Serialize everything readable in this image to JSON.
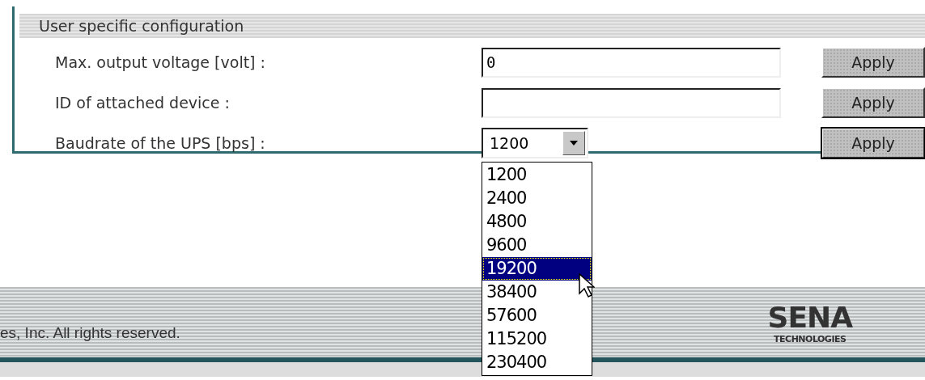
{
  "section": {
    "title": "User specific configuration",
    "settings": [
      {
        "kind": "text",
        "label": "Max. output voltage [volt] :",
        "value": "0",
        "button": "Apply",
        "default": false
      },
      {
        "kind": "text",
        "label": "ID of attached device :",
        "button": "Apply",
        "default": false
      },
      {
        "kind": "select",
        "label": "Baudrate of the UPS [bps] :",
        "value": "1200",
        "button": "Apply",
        "default": true
      }
    ]
  },
  "dropdown": {
    "options": [
      {
        "label": "1200",
        "selected": false
      },
      {
        "label": "2400",
        "selected": false
      },
      {
        "label": "4800",
        "selected": false
      },
      {
        "label": "9600",
        "selected": false
      },
      {
        "label": "19200",
        "selected": true
      },
      {
        "label": "38400",
        "selected": false
      },
      {
        "label": "57600",
        "selected": false
      },
      {
        "label": "115200",
        "selected": false
      },
      {
        "label": "230400",
        "selected": false
      }
    ]
  },
  "footer": {
    "copyright": "es, Inc. All rights reserved.",
    "logo": {
      "name": "SENA",
      "subtitle": "TECHNOLOGIES"
    }
  }
}
